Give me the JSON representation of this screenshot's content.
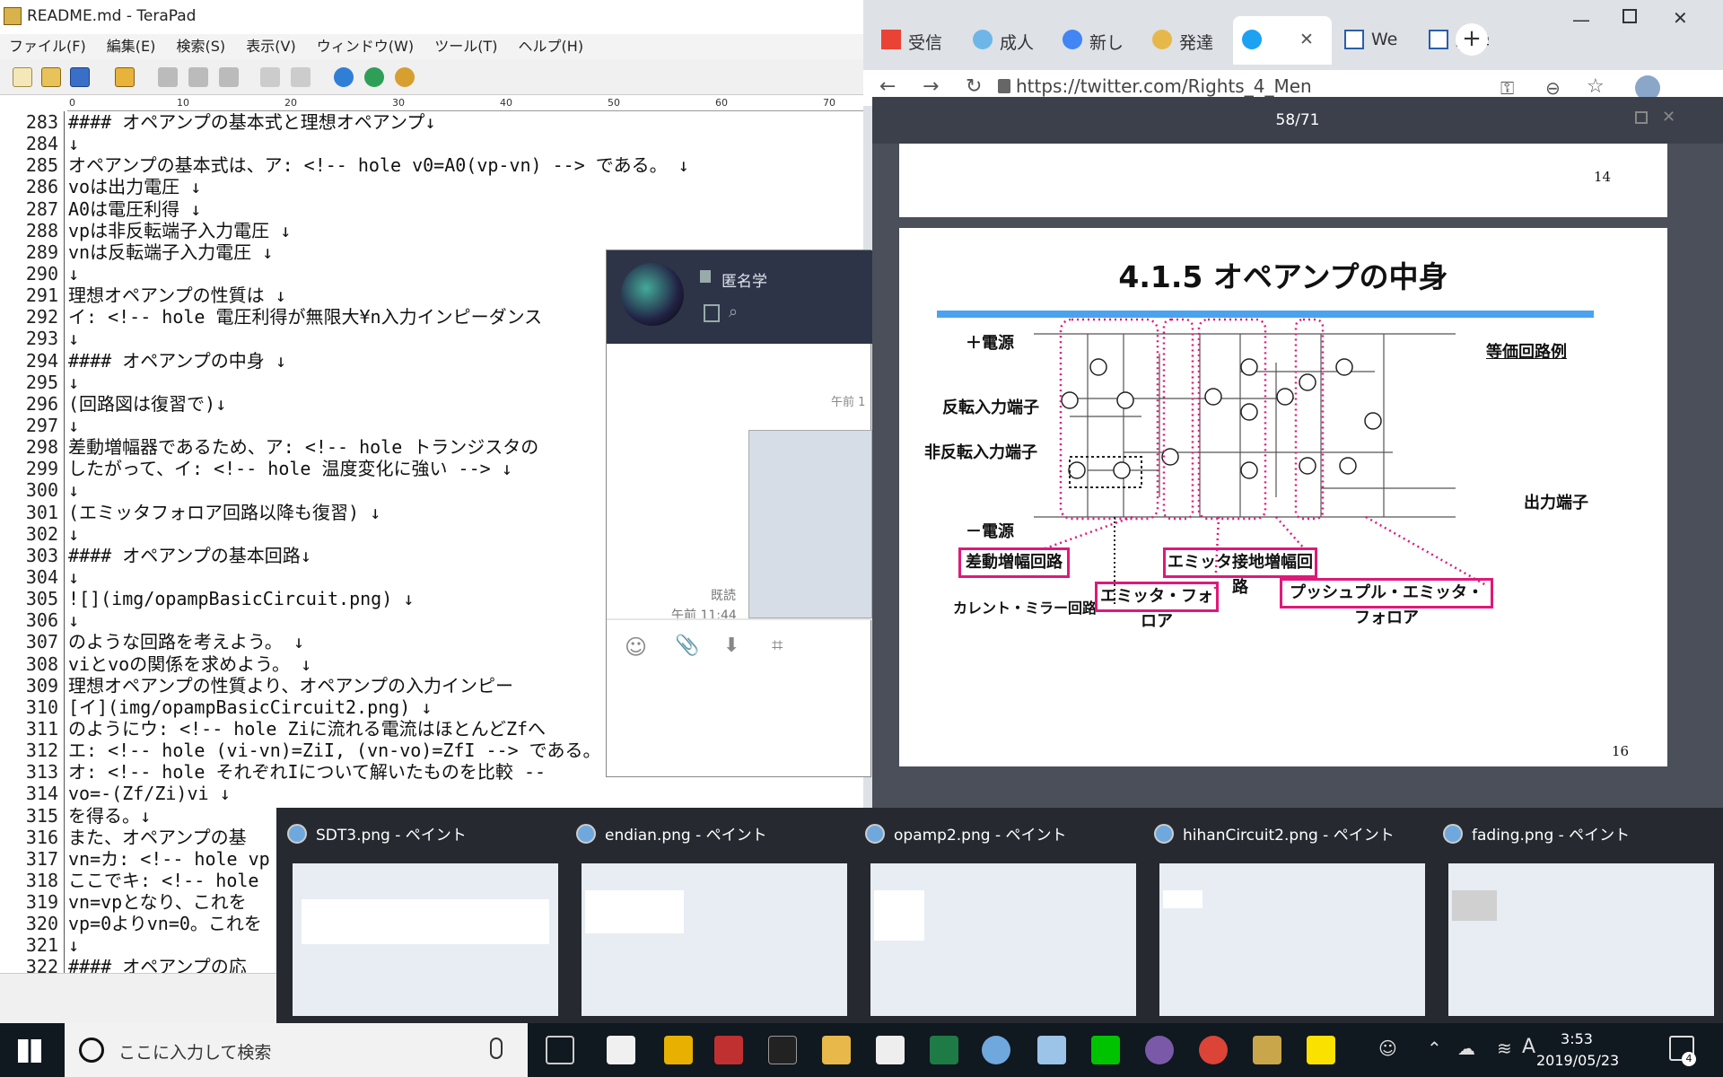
{
  "terapad": {
    "title": "README.md - TeraPad",
    "menu": [
      "ファイル(F)",
      "編集(E)",
      "検索(S)",
      "表示(V)",
      "ウィンドウ(W)",
      "ツール(T)",
      "ヘルプ(H)"
    ],
    "ruler": [
      "0",
      "10",
      "20",
      "30",
      "40",
      "50",
      "60",
      "70"
    ],
    "lines": [
      {
        "n": "283",
        "t": "#### オペアンプの基本式と理想オペアンプ↓"
      },
      {
        "n": "284",
        "t": "↓"
      },
      {
        "n": "285",
        "t": "オペアンプの基本式は、ア: <!-- hole v0=A0(vp-vn) --> である。 ↓"
      },
      {
        "n": "286",
        "t": "voは出力電圧 ↓"
      },
      {
        "n": "287",
        "t": "A0は電圧利得 ↓"
      },
      {
        "n": "288",
        "t": "vpは非反転端子入力電圧 ↓"
      },
      {
        "n": "289",
        "t": "vnは反転端子入力電圧 ↓"
      },
      {
        "n": "290",
        "t": "↓"
      },
      {
        "n": "291",
        "t": "理想オペアンプの性質は ↓"
      },
      {
        "n": "292",
        "t": "イ: <!-- hole 電圧利得が無限大¥n入力インピーダンス"
      },
      {
        "n": "293",
        "t": "↓"
      },
      {
        "n": "294",
        "t": "#### オペアンプの中身 ↓"
      },
      {
        "n": "295",
        "t": "↓"
      },
      {
        "n": "296",
        "t": "(回路図は復習で)↓"
      },
      {
        "n": "297",
        "t": "↓"
      },
      {
        "n": "298",
        "t": "差動増幅器であるため、ア: <!-- hole トランジスタの"
      },
      {
        "n": "299",
        "t": "したがって、イ: <!-- hole 温度変化に強い --> ↓"
      },
      {
        "n": "300",
        "t": "↓"
      },
      {
        "n": "301",
        "t": "(エミッタフォロア回路以降も復習) ↓"
      },
      {
        "n": "302",
        "t": "↓"
      },
      {
        "n": "303",
        "t": "#### オペアンプの基本回路↓"
      },
      {
        "n": "304",
        "t": "↓"
      },
      {
        "n": "305",
        "t": "![](img/opampBasicCircuit.png) ↓"
      },
      {
        "n": "306",
        "t": "↓"
      },
      {
        "n": "307",
        "t": "のような回路を考えよう。 ↓"
      },
      {
        "n": "308",
        "t": "viとvoの関係を求めよう。 ↓"
      },
      {
        "n": "309",
        "t": "理想オペアンプの性質より、オペアンプの入力インピー"
      },
      {
        "n": "310",
        "t": "[イ](img/opampBasicCircuit2.png) ↓"
      },
      {
        "n": "311",
        "t": "のようにウ: <!-- hole Ziに流れる電流はほとんどZfへ"
      },
      {
        "n": "312",
        "t": "エ: <!-- hole (vi-vn)=ZiI, (vn-vo)=ZfI --> である。"
      },
      {
        "n": "313",
        "t": "オ: <!-- hole それぞれIについて解いたものを比較 --"
      },
      {
        "n": "314",
        "t": "vo=-(Zf/Zi)vi ↓"
      },
      {
        "n": "315",
        "t": "を得る。↓"
      },
      {
        "n": "316",
        "t": "また、オペアンプの基"
      },
      {
        "n": "317",
        "t": "vn=カ: <!-- hole vp"
      },
      {
        "n": "318",
        "t": "ここでキ: <!-- hole"
      },
      {
        "n": "319",
        "t": "vn=vpとなり、これを"
      },
      {
        "n": "320",
        "t": "vp=0よりvn=0。これを"
      },
      {
        "n": "321",
        "t": "↓"
      },
      {
        "n": "322",
        "t": "#### オペアンプの応"
      }
    ]
  },
  "chrome": {
    "tabs": [
      "受信",
      "成人",
      "新し",
      "発達",
      "",
      "We",
      "科学"
    ],
    "url": "https://twitter.com/Rights_4_Men"
  },
  "viewer": {
    "counter": "58/71",
    "page_top_num": "14",
    "page_bottom_num": "16",
    "slide_title": "4.1.5  オペアンプの中身",
    "labels": {
      "plus_supply": "＋電源",
      "inv_in": "反転入力端子",
      "noninv_in": "非反転入力端子",
      "minus_supply": "－電源",
      "equiv": "等価回路例",
      "output": "出力端子",
      "current_mirror": "カレント・ミラー回路"
    },
    "boxes": {
      "diff": "差動増幅回路",
      "ce": "エミッタ接地増幅回路",
      "ef": "エミッタ・フォロア",
      "pp": "プッシュプル・エミッタ・フォロア"
    }
  },
  "chat": {
    "name": "匿名学",
    "time1": "午前 1",
    "read": "既読",
    "time2": "午前 11:44",
    "time3": "午前"
  },
  "previews": [
    {
      "title": "SDT3.png - ペイント"
    },
    {
      "title": "endian.png - ペイント"
    },
    {
      "title": "opamp2.png - ペイント"
    },
    {
      "title": "hihanCircuit2.png - ペイント"
    },
    {
      "title": "fading.png - ペイント"
    }
  ],
  "taskbar": {
    "search_placeholder": "ここに入力して検索",
    "time": "3:53",
    "date": "2019/05/23",
    "notif_count": "4"
  },
  "colors": {
    "accent_pink": "#e0187a",
    "slide_bar": "#4aa3ef",
    "taskbar": "#101820"
  }
}
